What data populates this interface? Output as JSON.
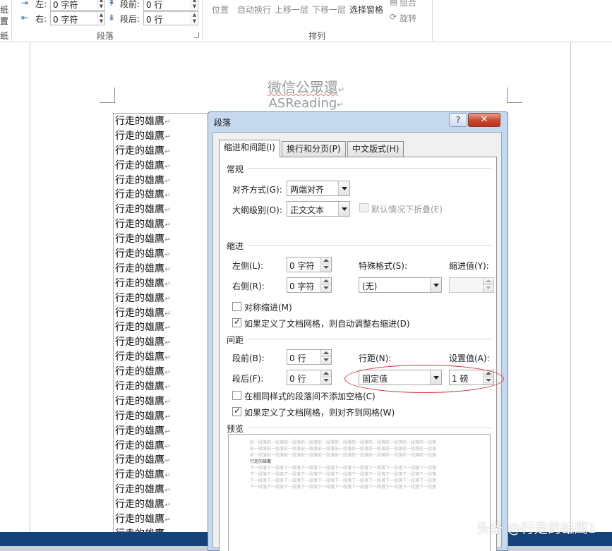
{
  "ribbon": {
    "left_edge": [
      "纸",
      "置",
      "纸"
    ],
    "indent_left_label": "左:",
    "indent_left_value": "0 字符",
    "indent_right_label": "右:",
    "indent_right_value": "0 字符",
    "spacing_before_label": "段前:",
    "spacing_before_value": "0 行",
    "spacing_after_label": "段后:",
    "spacing_after_value": "0 行",
    "paragraph_group_label": "段落",
    "arrange_items": [
      "位置",
      "自动换行",
      "上移一层",
      "下移一层",
      "选择窗格",
      "组合",
      "旋转"
    ],
    "arrange_group_label": "排列"
  },
  "document": {
    "title_line1": "微信公眾還",
    "title_line2": "ASReading",
    "lines": [
      "行走的雄鷹",
      "行走的雄鷹",
      "行走的雄鷹",
      "行走的雄鷹",
      "行走的雄鷹",
      "行走的雄鷹",
      "行走的雄鷹",
      "行走的雄鷹",
      "行走的雄鷹",
      "行走的雄鷹",
      "行走的雄鷹",
      "行走的雄鷹",
      "行走的雄鷹",
      "行走的雄鷹",
      "行走的雄鷹",
      "行走的雄鷹",
      "行走的雄鷹",
      "行走的雄鷹",
      "行走的雄鷹",
      "行走的雄鷹",
      "行走的雄鷹",
      "行走的雄鷹",
      "行走的雄鷹",
      "行走的雄鷹",
      "行走的雄鷹",
      "行走的雄鷹",
      "行走的雄鷹",
      "行走的雄鷹",
      "行走的雄鷹"
    ],
    "paragraph_mark": "↵"
  },
  "dialog": {
    "title": "段落",
    "help": "?",
    "close": "✕",
    "tabs": [
      "缩进和间距(I)",
      "换行和分页(P)",
      "中文版式(H)"
    ],
    "general_section": "常规",
    "alignment_label": "对齐方式(G):",
    "alignment_value": "两端对齐",
    "outline_label": "大纲级别(O):",
    "outline_value": "正文文本",
    "collapsed_label": "默认情况下折叠(E)",
    "indent_section": "缩进",
    "left_label": "左侧(L):",
    "left_value": "0 字符",
    "right_label": "右侧(R):",
    "right_value": "0 字符",
    "special_label": "特殊格式(S):",
    "special_value": "(无)",
    "indent_by_label": "缩进值(Y):",
    "indent_by_value": "",
    "mirror_label": "对称缩进(M)",
    "auto_adjust_label": "如果定义了文档网格，则自动调整右缩进(D)",
    "spacing_section": "间距",
    "before_label": "段前(B):",
    "before_value": "0 行",
    "after_label": "段后(F):",
    "after_value": "0 行",
    "line_spacing_label": "行距(N):",
    "line_spacing_value": "固定值",
    "at_label": "设置值(A):",
    "at_value": "1 磅",
    "no_space_label": "在相同样式的段落间不添加空格(C)",
    "snap_grid_label": "如果定义了文档网格，则对齐到网格(W)",
    "preview_section": "预览",
    "preview_prev": "前一段落前一段落前一段落前一段落前一段落前一段落前一段落前一段落前一段落前一段落前一段落",
    "preview_current": "行走的雄鷹",
    "preview_next": "下一段落下一段落下一段落下一段落下一段落下一段落下一段落下一段落下一段落下一段落下一段落"
  },
  "watermark": "头条 @行走的雄鹰1",
  "colors": {
    "highlight_ellipse": "#d7323a",
    "dialog_frame": "#c6d9ee",
    "taskbar": "#16427a"
  }
}
